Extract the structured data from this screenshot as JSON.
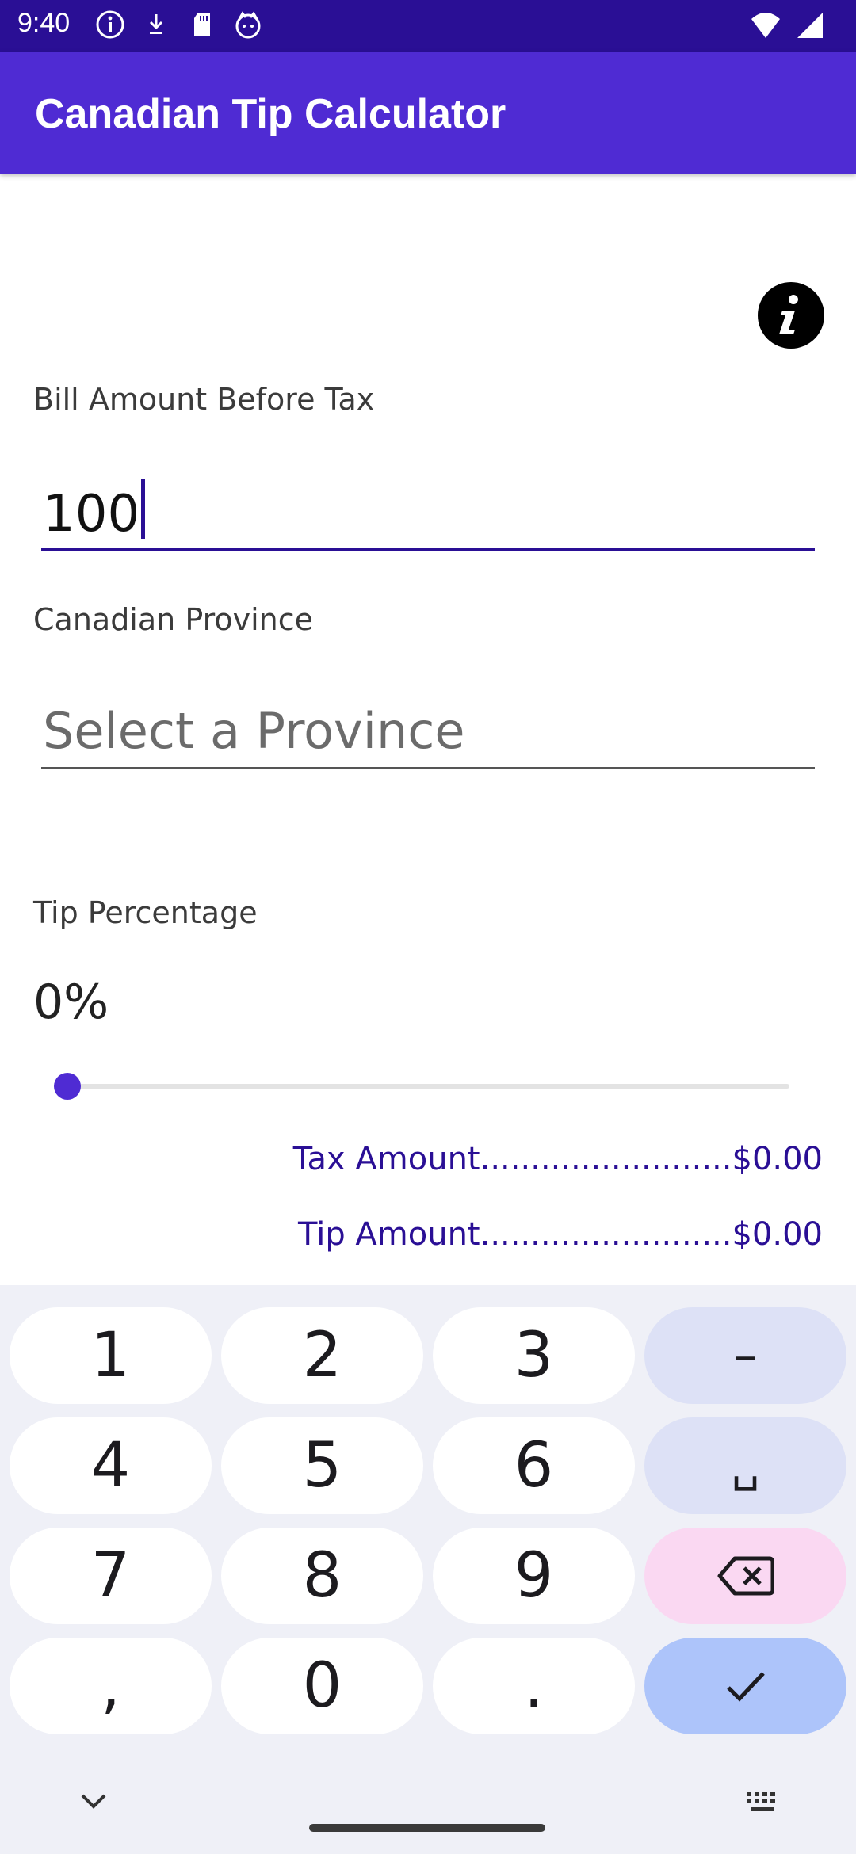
{
  "status_bar": {
    "time": "9:40",
    "icons": [
      "info-icon",
      "download-icon",
      "sd-card-icon",
      "cat-icon"
    ],
    "right_icons": [
      "wifi-icon",
      "signal-icon"
    ]
  },
  "app_bar": {
    "title": "Canadian Tip Calculator"
  },
  "info_button": {
    "icon": "info-icon"
  },
  "bill": {
    "label": "Bill Amount Before Tax",
    "value": "100"
  },
  "province": {
    "label": "Canadian Province",
    "placeholder": "Select a Province"
  },
  "tip": {
    "label": "Tip Percentage",
    "value": "0%",
    "slider_percent": 0
  },
  "summary": {
    "tax_line": "Tax Amount.........................$0.00",
    "tip_line": "Tip Amount.........................$0.00"
  },
  "keyboard": {
    "rows": [
      [
        "1",
        "2",
        "3",
        "–"
      ],
      [
        "4",
        "5",
        "6",
        "␣"
      ],
      [
        "7",
        "8",
        "9",
        "backspace-icon"
      ],
      [
        ",",
        "0",
        ".",
        "check-icon"
      ]
    ],
    "bottom_left_icon": "chevron-down-icon",
    "bottom_right_icon": "keyboard-icon"
  },
  "colors": {
    "status_bar": "#2a0f95",
    "app_bar": "#4f2bd3",
    "accent": "#2a0f95",
    "keyboard_bg": "#eff0f7"
  }
}
